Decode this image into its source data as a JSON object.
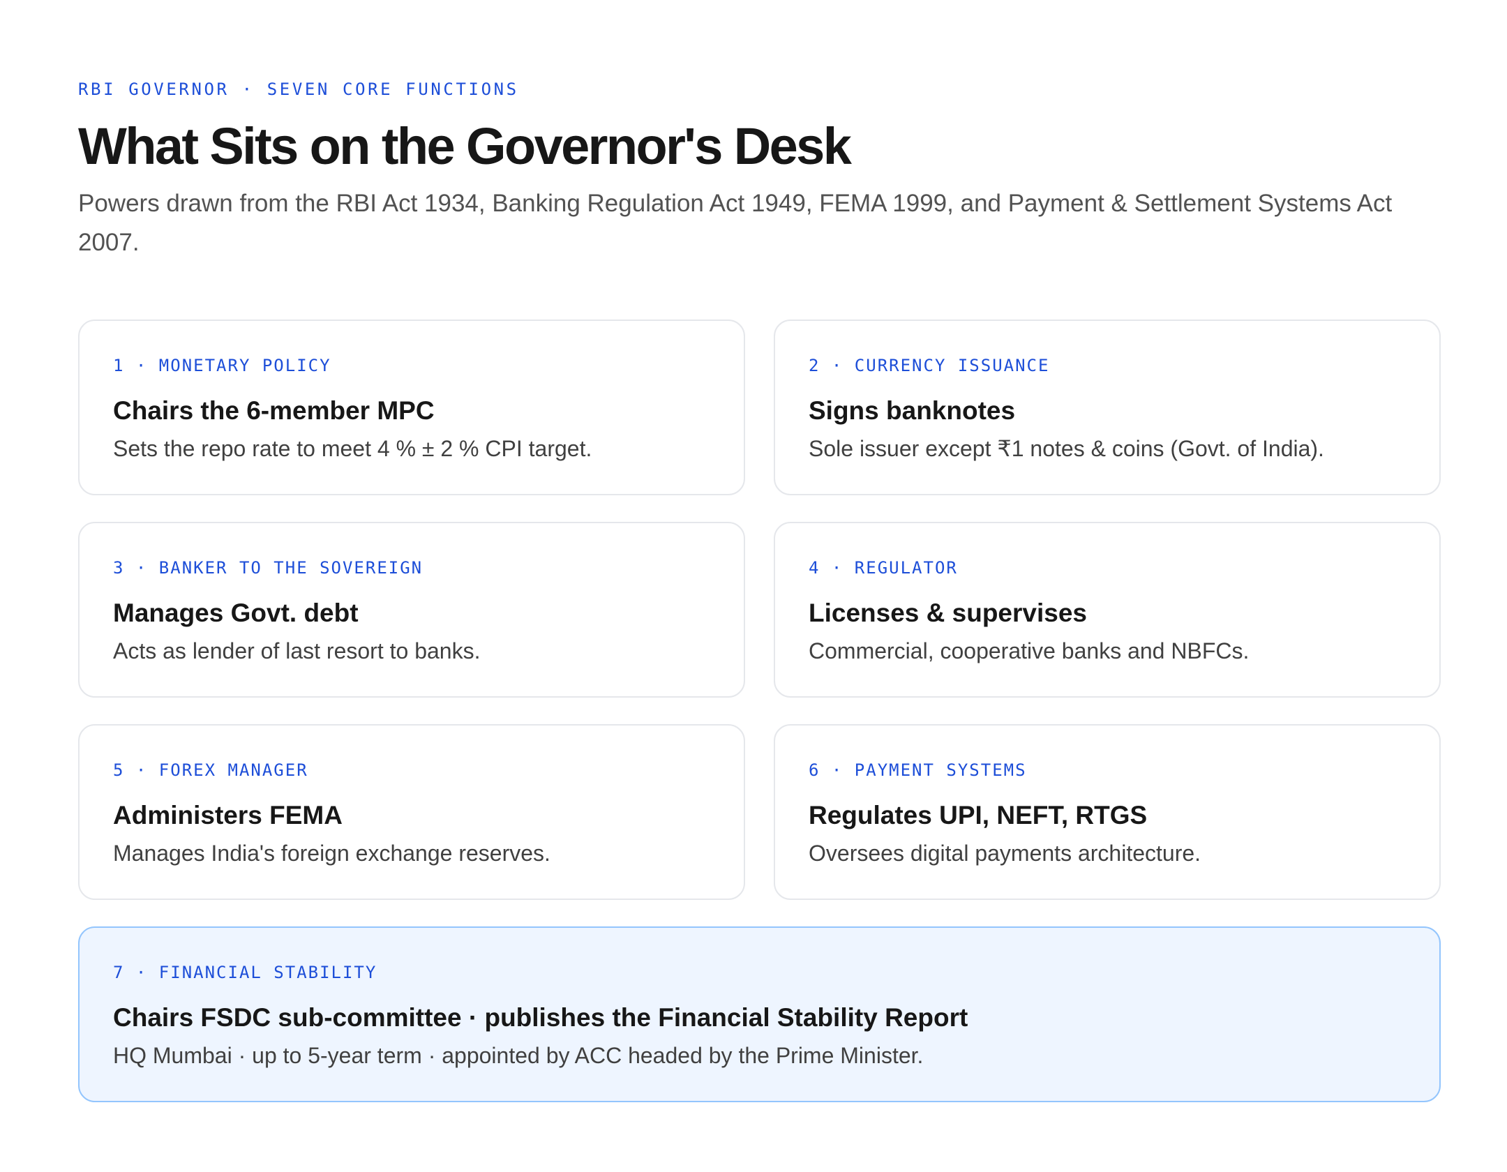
{
  "header": {
    "eyebrow": "RBI GOVERNOR · SEVEN CORE FUNCTIONS",
    "title": "What Sits on the Governor's Desk",
    "subtitle": "Powers drawn from the RBI Act 1934, Banking Regulation Act 1949, FEMA 1999, and Payment & Settlement Systems Act 2007."
  },
  "cards": [
    {
      "label": "1 · MONETARY POLICY",
      "heading": "Chairs the 6-member MPC",
      "body": "Sets the repo rate to meet 4 % ± 2 % CPI target."
    },
    {
      "label": "2 · CURRENCY ISSUANCE",
      "heading": "Signs banknotes",
      "body": "Sole issuer except ₹1 notes & coins (Govt. of India)."
    },
    {
      "label": "3 · BANKER TO THE SOVEREIGN",
      "heading": "Manages Govt. debt",
      "body": "Acts as lender of last resort to banks."
    },
    {
      "label": "4 · REGULATOR",
      "heading": "Licenses & supervises",
      "body": "Commercial, cooperative banks and NBFCs."
    },
    {
      "label": "5 · FOREX MANAGER",
      "heading": "Administers FEMA",
      "body": "Manages India's foreign exchange reserves."
    },
    {
      "label": "6 · PAYMENT SYSTEMS",
      "heading": "Regulates UPI, NEFT, RTGS",
      "body": "Oversees digital payments architecture."
    },
    {
      "label": "7 · FINANCIAL STABILITY",
      "heading": "Chairs FSDC sub-committee · publishes the Financial Stability Report",
      "body": "HQ Mumbai · up to 5-year term · appointed by ACC headed by the Prime Minister."
    }
  ],
  "colors": {
    "accent": "#1d4ed8",
    "card_border": "#e5e7eb",
    "featured_background": "#eef5ff",
    "featured_border": "#93c5fd"
  }
}
